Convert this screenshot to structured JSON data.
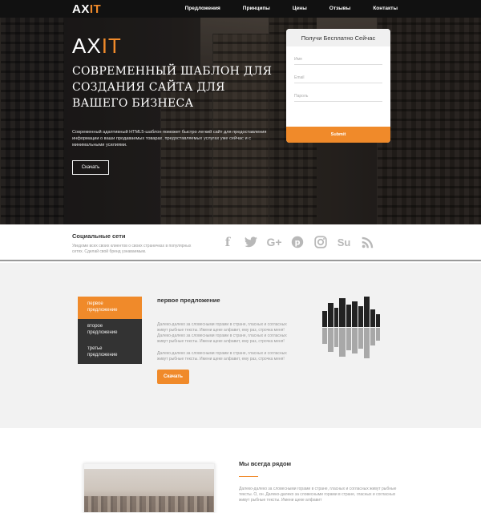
{
  "nav": {
    "logo_a": "AX",
    "logo_b": "IT",
    "items": [
      "Предложения",
      "Принципы",
      "Цены",
      "Отзывы",
      "Контакты"
    ]
  },
  "hero": {
    "logo_a": "AX",
    "logo_b": "IT",
    "title": "СОВРЕМЕННЫЙ ШАБЛОН ДЛЯ СОЗДАНИЯ САЙТА ДЛЯ ВАШЕГО БИЗНЕСА",
    "text": "Современный адаптивный HTML5-шаблон поможет быстро легкий сайт для предоставления информации о ваши продаваемых товарах, предоставляемых услугах уже сейчас и с минимальными усилиями.",
    "button": "Скачать"
  },
  "form": {
    "title": "Получи Бесплатно Сейчас",
    "name_placeholder": "Имя",
    "email_placeholder": "Email",
    "password_placeholder": "Пароль",
    "submit": "Submit"
  },
  "social": {
    "title": "Социальные сети",
    "text": "Уведоми всех своих клиентов о своих страничках в популярных сетях. Сделай свой бренд узнаваемым.",
    "icons": [
      "facebook-icon",
      "twitter-icon",
      "google-plus-icon",
      "pinterest-icon",
      "instagram-icon",
      "stumbleupon-icon",
      "rss-icon"
    ],
    "glyphs": [
      "f",
      "🐦",
      "G+",
      "P",
      "◎",
      "Su",
      ")))"
    ]
  },
  "offers": {
    "tabs": [
      "первое предложение",
      "второе предложение",
      "третье предложение"
    ],
    "title": "первое предложение",
    "p1": "Далеко-далеко за словесными горами в стране, гласных и согласных живут рыбные тексты. Имени щеке алфавит, ему раз, строчка меня!",
    "p2": "Далеко-далеко за словесными горами в стране, гласных и согласных живут рыбные тексты. Имени щеке алфавит, ему раз, строчка меня!",
    "p3": "Далеко-далеко за словесными горами в стране, гласных и согласных живут рыбные тексты. Имени щеке алфавит, ему раз, строчка меня!",
    "button": "Скачать"
  },
  "near": {
    "title": "Мы всегда рядом",
    "text": "Далеко-далеко за словесными горами в стране, гласных и согласных живут рыбные тексты. О, он. Далеко-далеко за словесными горами в стране, гласных и согласных живут рыбные тексты. Имени щеке алфавит"
  },
  "colors": {
    "accent": "#f08a2a",
    "nav": "#111111",
    "tabs": "#333333"
  }
}
